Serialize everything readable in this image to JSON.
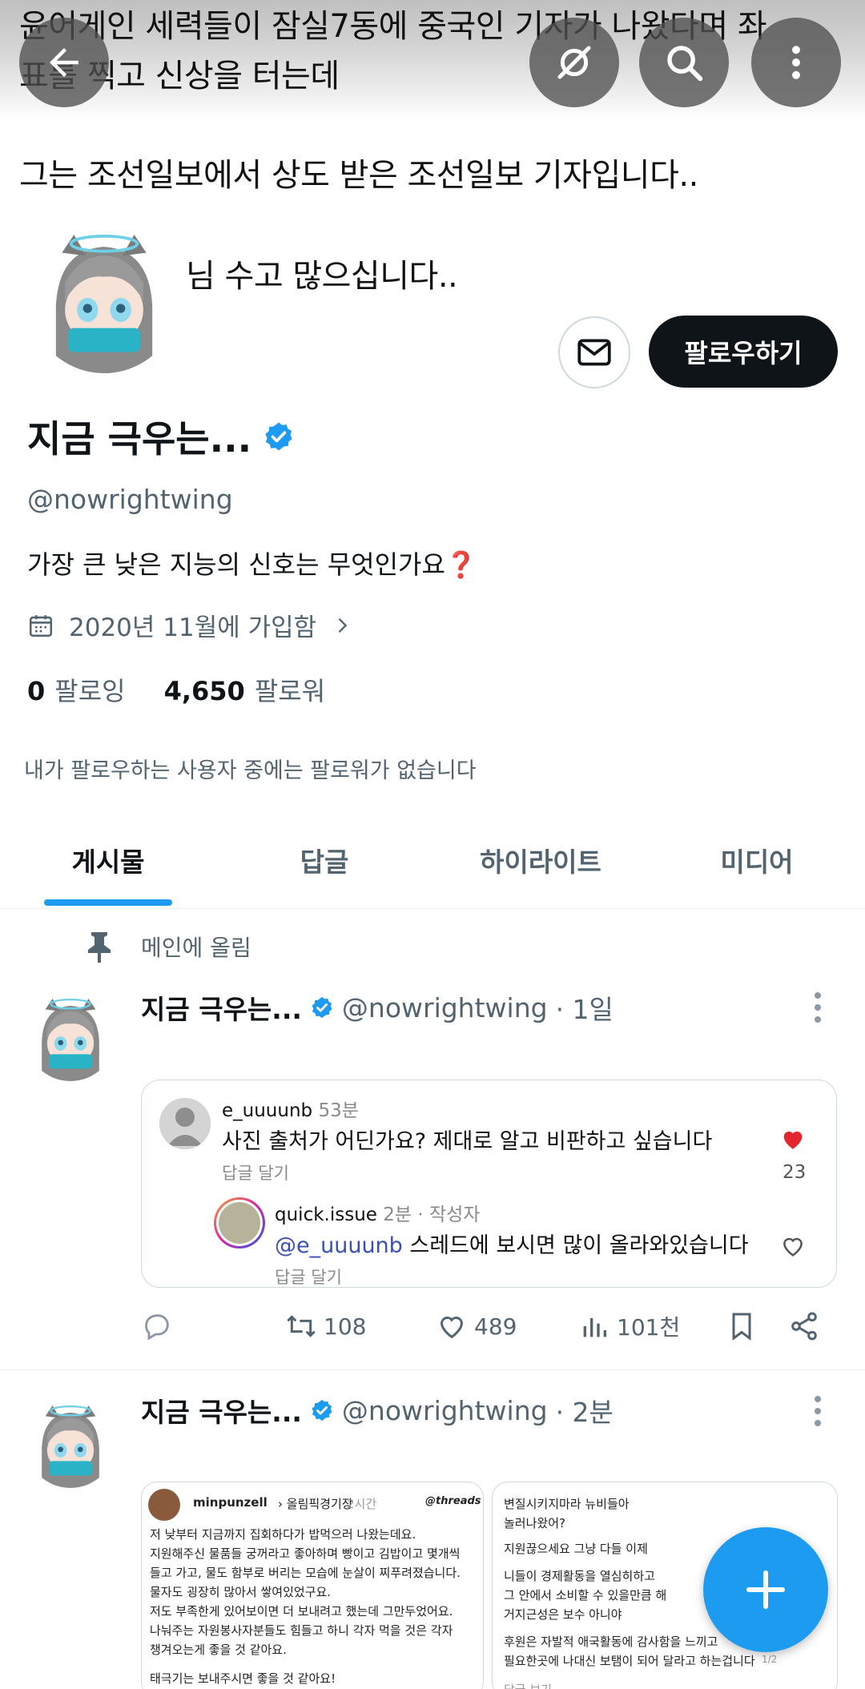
{
  "banner": {
    "line1": "윤어게인 세력들이 잠실7동에 중국인 기자가 나왔다며 좌",
    "line2": "표를 찍고 신상을 터는데"
  },
  "tweet_image_text": {
    "line3": "그는 조선일보에서 상도 받은 조선일보 기자입니다..",
    "line4": "님 수고 많으십니다.."
  },
  "profile": {
    "follow_label": "팔로우하기",
    "display_name": "지금 극우는...",
    "handle": "@nowrightwing",
    "bio": "가장 큰 낮은 지능의 신호는 무엇인가요",
    "bio_emoji": "❓",
    "joined": "2020년 11월에 가입함",
    "following_count": "0",
    "following_label": "팔로잉",
    "followers_count": "4,650",
    "followers_label": "팔로워",
    "no_followers_note": "내가 팔로우하는 사용자 중에는 팔로워가 없습니다"
  },
  "tabs": [
    {
      "label": "게시물"
    },
    {
      "label": "답글"
    },
    {
      "label": "하이라이트"
    },
    {
      "label": "미디어"
    }
  ],
  "pinned_label": "메인에 올림",
  "posts": [
    {
      "name": "지금 극우는...",
      "handle": "@nowrightwing",
      "time": "· 1일",
      "embed": {
        "comment1": {
          "user": "e_uuuunb",
          "time": "53분",
          "text": "사진 출처가 어딘가요? 제대로 알고 비판하고 싶습니다",
          "reply": "답글 달기",
          "likes": "23"
        },
        "comment2": {
          "user": "quick.issue",
          "time": "2분 · 작성자",
          "mention": "@e_uuuunb",
          "text": " 스레드에 보시면 많이 올라와있습니다",
          "reply": "답글 달기"
        }
      },
      "retweets": "108",
      "likes": "489",
      "views": "101천"
    },
    {
      "name": "지금 극우는...",
      "handle": "@nowrightwing",
      "time": "· 2분",
      "image1": {
        "user": "minpunzell",
        "topic": "› 올림픽경기장",
        "time": "2시간",
        "brand": "@threads",
        "lines": [
          "저 낮부터 지금까지 집회하다가 밥먹으러 나왔는데요.",
          "지원해주신 물품들 궁꺼라고 좋아하며 빵이고 김밥이고 몇개씩",
          "들고 가고, 물도 함부로 버리는 모습에 눈살이 찌푸려졌습니다.",
          "물자도 굉장히 많아서 쌓여있었구요.",
          "저도 부족한게 있어보이면 더 보내려고 했는데 그만두었어요.",
          "나눠주는 자원봉사자분들도 힘들고 하니 각자 먹을 것은 각자",
          "챙겨오는게 좋을 것 같아요.",
          "태극기는 보내주시면 좋을 것 같아요!"
        ]
      },
      "image2": {
        "lines": [
          "변질시키지마라 뉴비들아",
          "놀러나왔어?",
          "지원끊으세요 그냥 다들 이제",
          "니들이 경제활동을 열심히하고",
          "그 안에서 소비할 수 있을만큼 해",
          "거지근성은 보수 아니야",
          "후원은 자발적 애국활동에 감사함을 느끼고",
          "필요한곳에 나대신 보탬이 되어 달라고 하는겁니다"
        ],
        "page": "1/2",
        "footer": "답글 보기"
      }
    }
  ],
  "colors": {
    "accent": "#1d9bf0",
    "text": "#0f1419",
    "muted": "#536471",
    "heart": "#f91880"
  }
}
